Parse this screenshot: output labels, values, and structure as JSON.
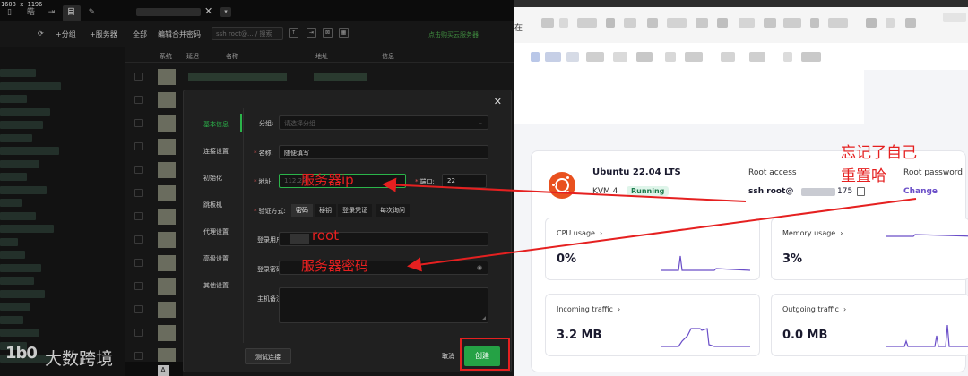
{
  "app": {
    "size_label": "1608 x 1196",
    "tab_icons": [
      "▯",
      "皓",
      "⇥",
      "目",
      "✎"
    ],
    "toolbar": {
      "refresh": "⟳",
      "add_group": "+分组",
      "add_server": "+服务器",
      "all": "全部",
      "edit_password": "编辑合并密码",
      "search_placeholder": "ssh root@... / 搜索",
      "link": "点击购买云服务器"
    },
    "columns": [
      "系统",
      "延迟",
      "名称",
      "地址",
      "信息"
    ]
  },
  "modal": {
    "close": "✕",
    "nav": [
      "基本信息",
      "连接设置",
      "初始化",
      "跳板机",
      "代理设置",
      "高级设置",
      "其他设置"
    ],
    "fields": {
      "group_label": "分组:",
      "group_placeholder": "请选择分组",
      "name_label": "名称:",
      "name_value": "随便填写",
      "address_label": "地址:",
      "address_value": "112.22",
      "port_label": "端口:",
      "port_value": "22",
      "auth_label": "验证方式:",
      "auth_options": [
        "密码",
        "秘钥",
        "登录凭证",
        "每次询问"
      ],
      "user_label": "登录用户:",
      "password_label": "登录密码:",
      "note_label": "主机备注:"
    },
    "buttons": {
      "test": "测试连接",
      "cancel": "取消",
      "create": "创建"
    }
  },
  "annotations": {
    "server_ip": "服务器ip",
    "root": "root",
    "server_password": "服务器密码",
    "forgot_line1": "忘记了自己",
    "forgot_line2": "重置哈"
  },
  "watermark": {
    "logo": "1b0",
    "text": "大数跨境"
  },
  "browser": {
    "tab_text": "在",
    "server": {
      "os_name": "Ubuntu 22.04 LTS",
      "plan": "KVM 4",
      "status": "Running",
      "root_access_label": "Root access",
      "root_access_value": "ssh root@",
      "root_access_suffix": "175",
      "root_password_label": "Root password",
      "root_password_action": "Change"
    },
    "metrics": [
      {
        "label": "CPU usage",
        "value": "0%"
      },
      {
        "label": "Memory usage",
        "value": "3%"
      },
      {
        "label": "Incoming traffic",
        "value": "3.2 MB"
      },
      {
        "label": "Outgoing traffic",
        "value": "0.0 MB"
      }
    ],
    "colors": {
      "accent": "#6a4ec8",
      "running_bg": "#dff5ea",
      "running_text": "#1d7b4d",
      "ubuntu": "#e9511f"
    }
  }
}
